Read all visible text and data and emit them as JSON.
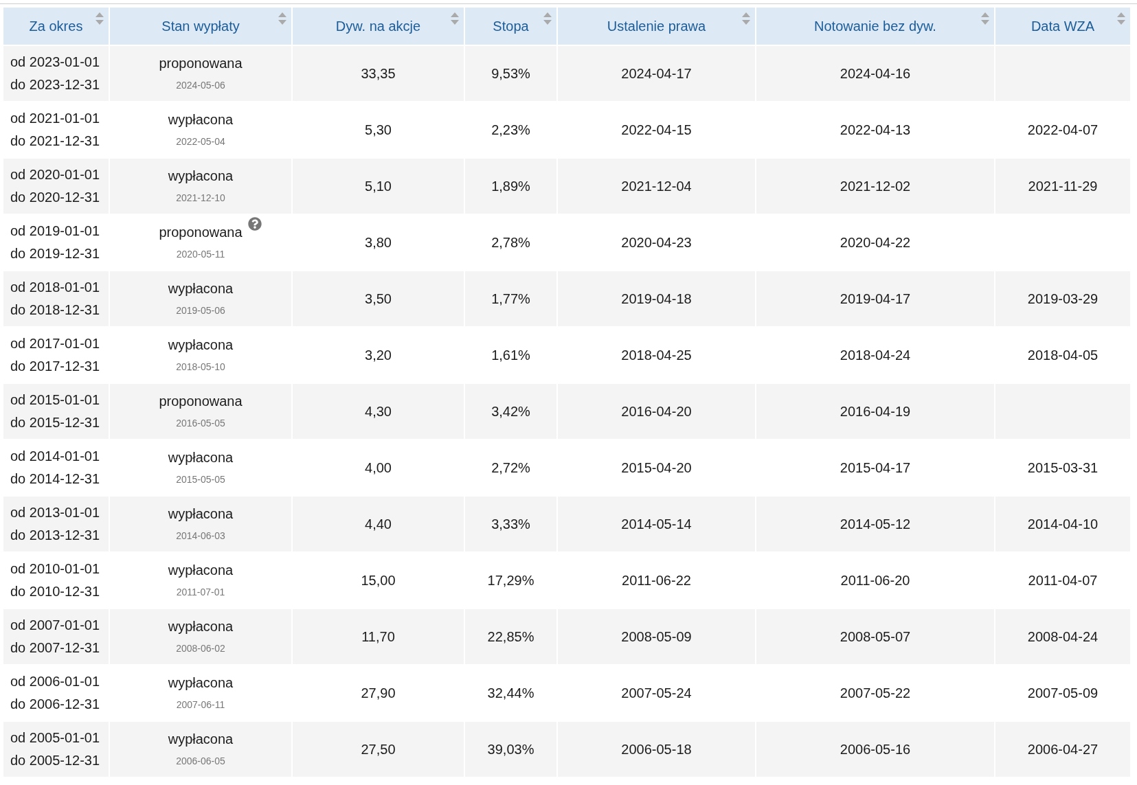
{
  "columns": [
    "Za okres",
    "Stan wypłaty",
    "Dyw. na akcje",
    "Stopa",
    "Ustalenie prawa",
    "Notowanie bez dyw.",
    "Data WZA"
  ],
  "rows": [
    {
      "period_from": "od 2023-01-01",
      "period_to": "do 2023-12-31",
      "status": "proponowana",
      "status_date": "2024-05-06",
      "help": false,
      "dividend": "33,35",
      "rate": "9,53%",
      "record_date": "2024-04-17",
      "ex_date": "2024-04-16"
    },
    {
      "period_from": "od 2021-01-01",
      "period_to": "do 2021-12-31",
      "status": "wypłacona",
      "status_date": "2022-05-04",
      "help": false,
      "dividend": "5,30",
      "rate": "2,23%",
      "record_date": "2022-04-15",
      "ex_date": "2022-04-13",
      "agm_date": "2022-04-07"
    },
    {
      "period_from": "od 2020-01-01",
      "period_to": "do 2020-12-31",
      "status": "wypłacona",
      "status_date": "2021-12-10",
      "help": false,
      "dividend": "5,10",
      "rate": "1,89%",
      "record_date": "2021-12-04",
      "ex_date": "2021-12-02",
      "agm_date": "2021-11-29"
    },
    {
      "period_from": "od 2019-01-01",
      "period_to": "do 2019-12-31",
      "status": "proponowana",
      "status_date": "2020-05-11",
      "help": true,
      "dividend": "3,80",
      "rate": "2,78%",
      "record_date": "2020-04-23",
      "ex_date": "2020-04-22"
    },
    {
      "period_from": "od 2018-01-01",
      "period_to": "do 2018-12-31",
      "status": "wypłacona",
      "status_date": "2019-05-06",
      "help": false,
      "dividend": "3,50",
      "rate": "1,77%",
      "record_date": "2019-04-18",
      "ex_date": "2019-04-17",
      "agm_date": "2019-03-29"
    },
    {
      "period_from": "od 2017-01-01",
      "period_to": "do 2017-12-31",
      "status": "wypłacona",
      "status_date": "2018-05-10",
      "help": false,
      "dividend": "3,20",
      "rate": "1,61%",
      "record_date": "2018-04-25",
      "ex_date": "2018-04-24",
      "agm_date": "2018-04-05"
    },
    {
      "period_from": "od 2015-01-01",
      "period_to": "do 2015-12-31",
      "status": "proponowana",
      "status_date": "2016-05-05",
      "help": false,
      "dividend": "4,30",
      "rate": "3,42%",
      "record_date": "2016-04-20",
      "ex_date": "2016-04-19"
    },
    {
      "period_from": "od 2014-01-01",
      "period_to": "do 2014-12-31",
      "status": "wypłacona",
      "status_date": "2015-05-05",
      "help": false,
      "dividend": "4,00",
      "rate": "2,72%",
      "record_date": "2015-04-20",
      "ex_date": "2015-04-17",
      "agm_date": "2015-03-31"
    },
    {
      "period_from": "od 2013-01-01",
      "period_to": "do 2013-12-31",
      "status": "wypłacona",
      "status_date": "2014-06-03",
      "help": false,
      "dividend": "4,40",
      "rate": "3,33%",
      "record_date": "2014-05-14",
      "ex_date": "2014-05-12",
      "agm_date": "2014-04-10"
    },
    {
      "period_from": "od 2010-01-01",
      "period_to": "do 2010-12-31",
      "status": "wypłacona",
      "status_date": "2011-07-01",
      "help": false,
      "dividend": "15,00",
      "rate": "17,29%",
      "record_date": "2011-06-22",
      "ex_date": "2011-06-20",
      "agm_date": "2011-04-07"
    },
    {
      "period_from": "od 2007-01-01",
      "period_to": "do 2007-12-31",
      "status": "wypłacona",
      "status_date": "2008-06-02",
      "help": false,
      "dividend": "11,70",
      "rate": "22,85%",
      "record_date": "2008-05-09",
      "ex_date": "2008-05-07",
      "agm_date": "2008-04-24"
    },
    {
      "period_from": "od 2006-01-01",
      "period_to": "do 2006-12-31",
      "status": "wypłacona",
      "status_date": "2007-06-11",
      "help": false,
      "dividend": "27,90",
      "rate": "32,44%",
      "record_date": "2007-05-24",
      "ex_date": "2007-05-22",
      "agm_date": "2007-05-09"
    },
    {
      "period_from": "od 2005-01-01",
      "period_to": "do 2005-12-31",
      "status": "wypłacona",
      "status_date": "2006-06-05",
      "help": false,
      "dividend": "27,50",
      "rate": "39,03%",
      "record_date": "2006-05-18",
      "ex_date": "2006-05-16",
      "agm_date": "2006-04-27"
    }
  ]
}
